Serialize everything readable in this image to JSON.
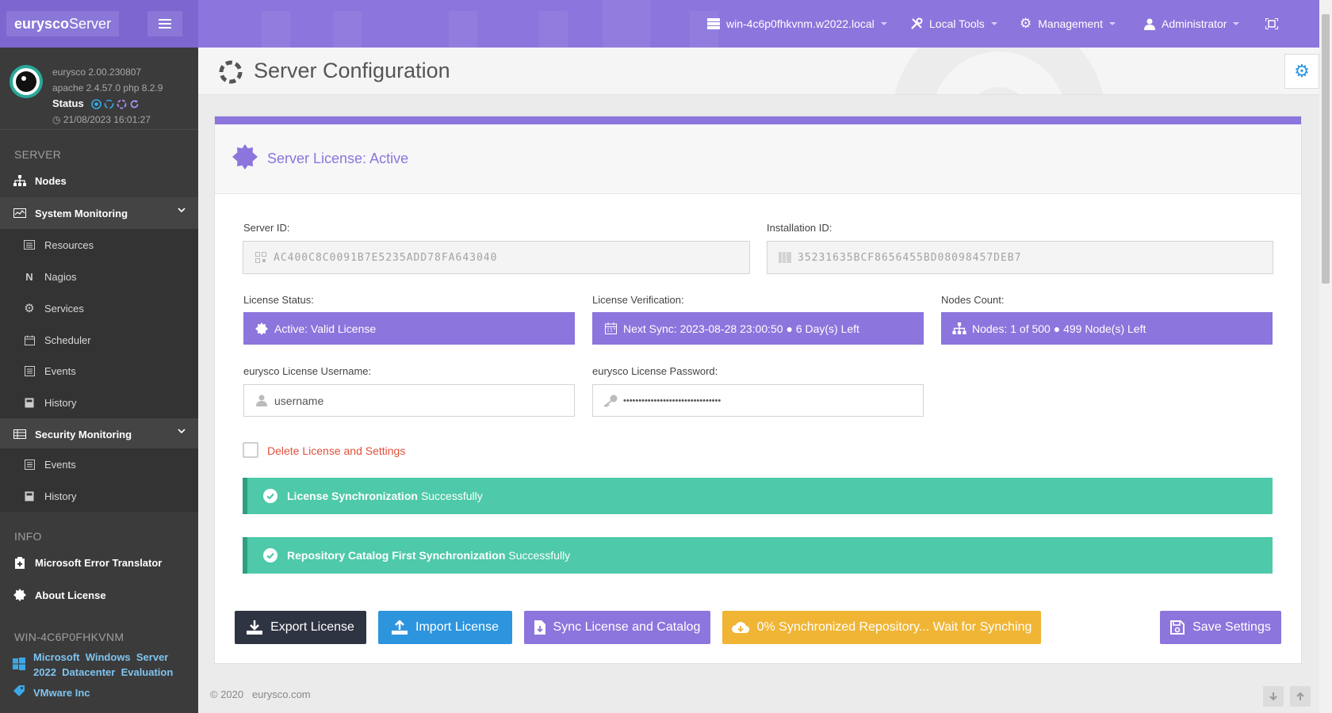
{
  "brand": {
    "bold": "eurysco",
    "light": "Server"
  },
  "profile": {
    "version": "eurysco 2.00.230807",
    "stack": "apache 2.4.57.0  php 8.2.9",
    "status_label": "Status",
    "datetime": "21/08/2023 16:01:27"
  },
  "sidebar": {
    "server_section": "SERVER",
    "nodes": "Nodes",
    "system_monitoring": "System Monitoring",
    "sys_items": [
      "Resources",
      "Nagios",
      "Services",
      "Scheduler",
      "Events",
      "History"
    ],
    "security_monitoring": "Security Monitoring",
    "sec_items": [
      "Events",
      "History"
    ],
    "info_section": "INFO",
    "error_translator": "Microsoft Error Translator",
    "about_license": "About License",
    "host_section": "WIN-4C6P0FHKVNM",
    "os_name": "Microsoft  Windows  Server  2022  Datacenter  Evaluation",
    "vendor": "VMware Inc"
  },
  "topbar": {
    "host": "win-4c6p0fhkvnm.w2022.local",
    "local_tools": "Local Tools",
    "management": "Management",
    "user": "Administrator"
  },
  "page": {
    "title": "Server Configuration"
  },
  "license": {
    "title": "Server License: Active",
    "server_id_label": "Server ID:",
    "server_id": "AC400C8C0091B7E5235ADD78FA643040",
    "installation_id_label": "Installation ID:",
    "installation_id": "35231635BCF8656455BD08098457DEB7",
    "status_label": "License Status:",
    "status_value": "Active: Valid License",
    "verification_label": "License Verification:",
    "verification_value": "Next Sync: 2023-08-28 23:00:50 ● 6 Day(s) Left",
    "nodes_label": "Nodes Count:",
    "nodes_value": "Nodes: 1 of 500 ● 499 Node(s) Left",
    "username_label": "eurysco License Username:",
    "username_value": "username",
    "password_label": "eurysco License Password:",
    "password_value": "••••••••••••••••••••••••••••••••",
    "delete_label": "Delete License and Settings"
  },
  "alerts": [
    {
      "bold": "License Synchronization",
      "text": "Successfully"
    },
    {
      "bold": "Repository Catalog First Synchronization",
      "text": "Successfully"
    }
  ],
  "buttons": {
    "export": "Export License",
    "import": "Import License",
    "sync": "Sync License and Catalog",
    "repo": "0% Synchronized Repository... Wait for Synching",
    "save": "Save Settings"
  },
  "footer": {
    "copyright": "© 2020   eurysco.com"
  },
  "colors": {
    "accent": "#8c75dc",
    "success": "#4ec9a9",
    "warning": "#f0b535",
    "info": "#2d95de",
    "dark": "#2f3442",
    "danger": "#e0503c"
  }
}
